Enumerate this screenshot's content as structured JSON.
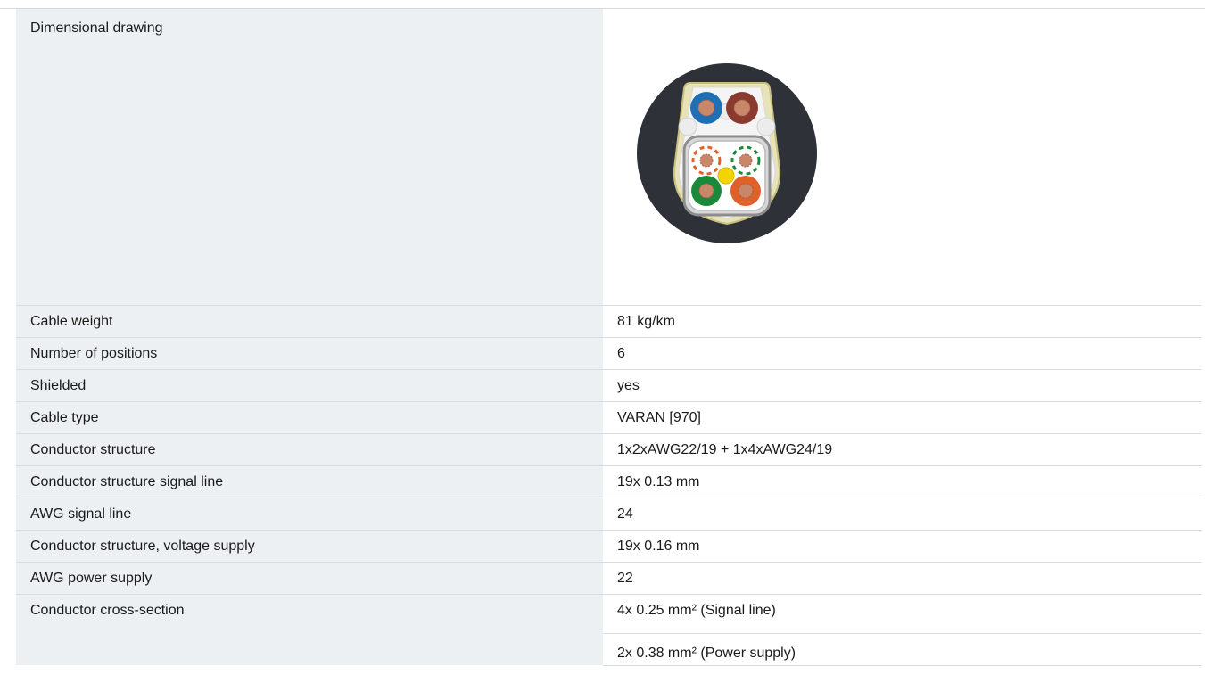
{
  "section": {
    "heading": ""
  },
  "drawing": {
    "label": "Dimensional drawing",
    "image_name": "cable-cross-section"
  },
  "rows": [
    {
      "label": "Cable weight",
      "value": "81 kg/km"
    },
    {
      "label": "Number of positions",
      "value": "6"
    },
    {
      "label": "Shielded",
      "value": "yes"
    },
    {
      "label": "Cable type",
      "value": "VARAN [970]"
    },
    {
      "label": "Conductor structure",
      "value": "1x2xAWG22/19 + 1x4xAWG24/19"
    },
    {
      "label": "Conductor structure signal line",
      "value": "19x 0.13 mm"
    },
    {
      "label": "AWG signal line",
      "value": "24"
    },
    {
      "label": "Conductor structure, voltage supply",
      "value": "19x 0.16 mm"
    },
    {
      "label": "AWG power supply",
      "value": "22"
    }
  ],
  "cross_section": {
    "label": "Conductor cross-section",
    "values": [
      "4x 0.25 mm² (Signal line)",
      "2x 0.38 mm² (Power supply)"
    ]
  },
  "colors": {
    "jacket": "#2e3138",
    "conductor_blue": "#1f6fb5",
    "conductor_brown": "#8b3a2f",
    "conductor_green": "#1a8a3a",
    "conductor_orange": "#e0602a",
    "filler_yellow": "#f2d400"
  }
}
